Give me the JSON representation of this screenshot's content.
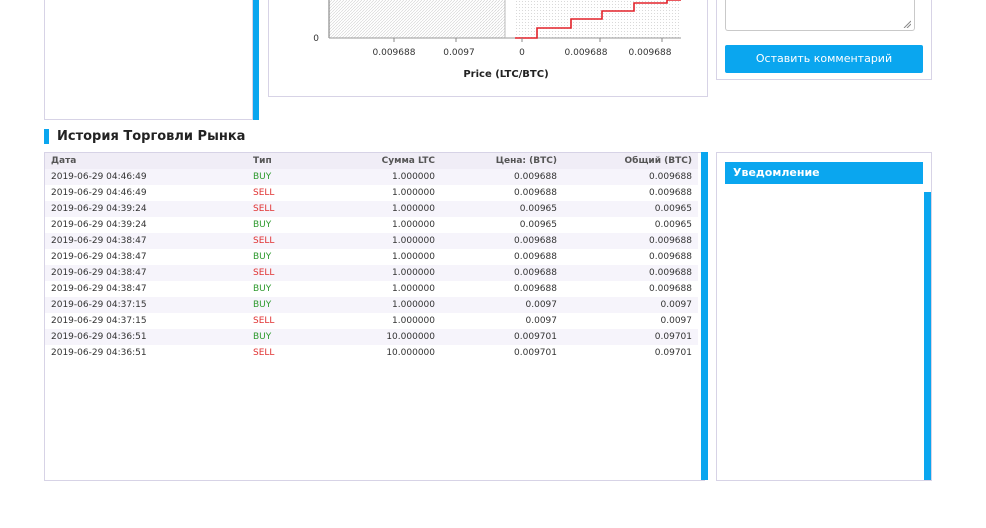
{
  "chart": {
    "y_tick": "0",
    "x_ticks": [
      "0.009688",
      "0.0097",
      "0",
      "0.009688",
      "0.009688"
    ],
    "x_label": "Price (LTC/BTC)",
    "colors": {
      "ask_line": "#e3222a",
      "bid_fill": "#cfcfcf"
    }
  },
  "comment": {
    "button_label": "Оставить комментарий"
  },
  "trade_history": {
    "title": "История Торговли Рынка",
    "columns": [
      "Дата",
      "Тип",
      "Сумма LTC",
      "Цена: (BTC)",
      "Общий (BTC)"
    ],
    "rows": [
      {
        "date": "2019-06-29 04:46:49",
        "type": "BUY",
        "amount": "1.000000",
        "price": "0.009688",
        "total": "0.009688"
      },
      {
        "date": "2019-06-29 04:46:49",
        "type": "SELL",
        "amount": "1.000000",
        "price": "0.009688",
        "total": "0.009688"
      },
      {
        "date": "2019-06-29 04:39:24",
        "type": "SELL",
        "amount": "1.000000",
        "price": "0.00965",
        "total": "0.00965"
      },
      {
        "date": "2019-06-29 04:39:24",
        "type": "BUY",
        "amount": "1.000000",
        "price": "0.00965",
        "total": "0.00965"
      },
      {
        "date": "2019-06-29 04:38:47",
        "type": "SELL",
        "amount": "1.000000",
        "price": "0.009688",
        "total": "0.009688"
      },
      {
        "date": "2019-06-29 04:38:47",
        "type": "BUY",
        "amount": "1.000000",
        "price": "0.009688",
        "total": "0.009688"
      },
      {
        "date": "2019-06-29 04:38:47",
        "type": "SELL",
        "amount": "1.000000",
        "price": "0.009688",
        "total": "0.009688"
      },
      {
        "date": "2019-06-29 04:38:47",
        "type": "BUY",
        "amount": "1.000000",
        "price": "0.009688",
        "total": "0.009688"
      },
      {
        "date": "2019-06-29 04:37:15",
        "type": "BUY",
        "amount": "1.000000",
        "price": "0.0097",
        "total": "0.0097"
      },
      {
        "date": "2019-06-29 04:37:15",
        "type": "SELL",
        "amount": "1.000000",
        "price": "0.0097",
        "total": "0.0097"
      },
      {
        "date": "2019-06-29 04:36:51",
        "type": "BUY",
        "amount": "10.000000",
        "price": "0.009701",
        "total": "0.09701"
      },
      {
        "date": "2019-06-29 04:36:51",
        "type": "SELL",
        "amount": "10.000000",
        "price": "0.009701",
        "total": "0.09701"
      }
    ]
  },
  "notifications": {
    "title": "Уведомление"
  },
  "colors": {
    "accent": "#0aa6ef",
    "buy": "#2e9a2e",
    "sell": "#e03131"
  }
}
